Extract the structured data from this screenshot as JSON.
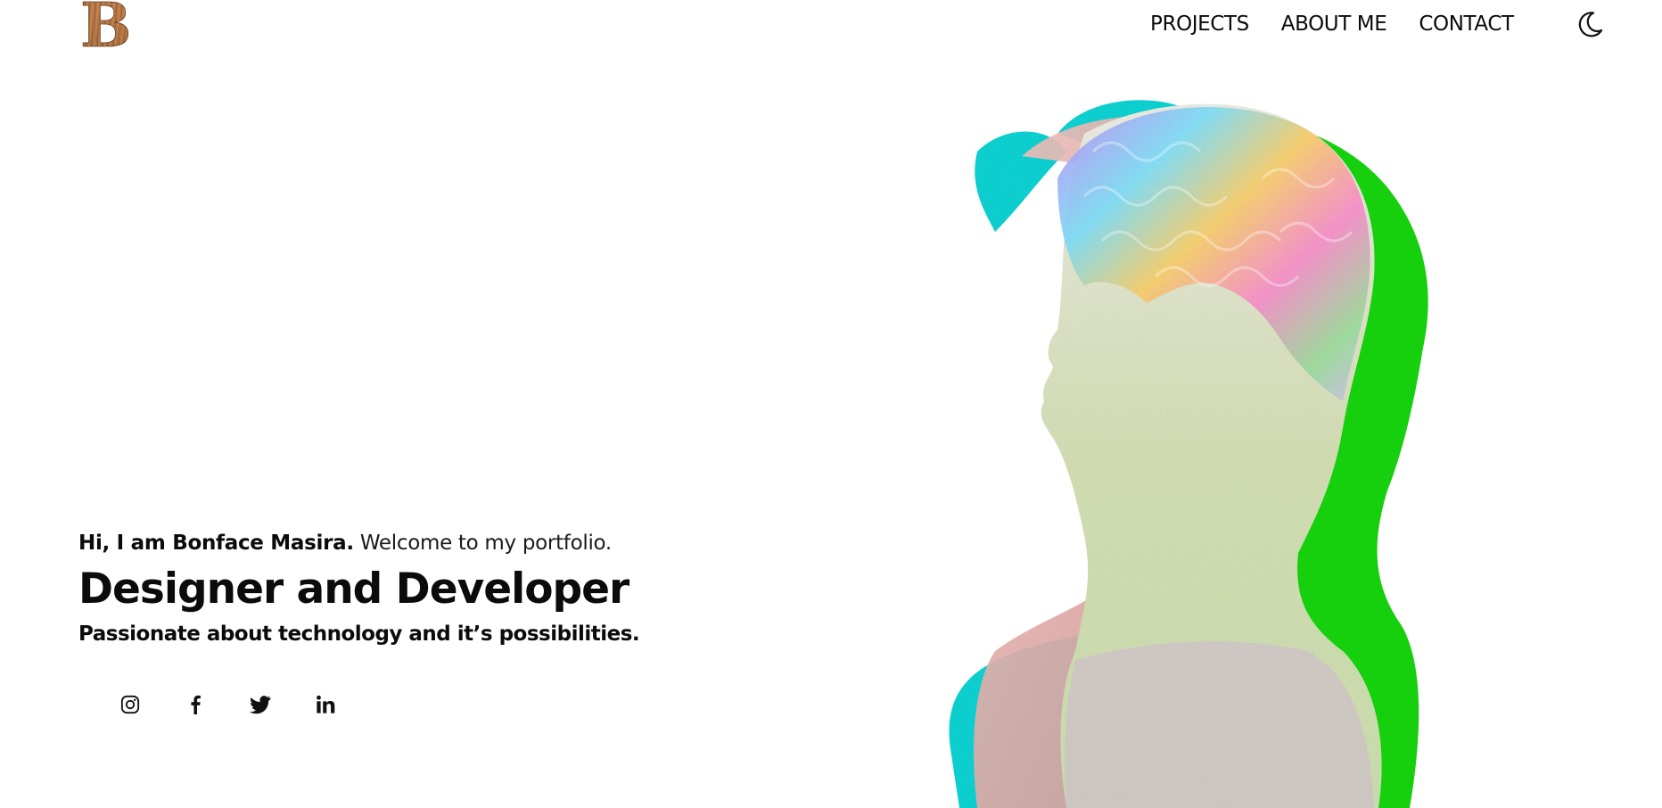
{
  "header": {
    "logo_letter": "B",
    "nav": [
      {
        "label": "PROJECTS"
      },
      {
        "label": "ABOUT ME"
      },
      {
        "label": "CONTACT"
      }
    ],
    "theme_toggle_icon": "moon-icon"
  },
  "hero": {
    "greeting_name": "Hi, I am Bonface Masira.",
    "greeting_welcome": "Welcome to my portfolio.",
    "title": "Designer and Developer",
    "tagline": "Passionate about technology and it’s possibilities."
  },
  "socials": [
    {
      "icon": "instagram-icon"
    },
    {
      "icon": "facebook-icon"
    },
    {
      "icon": "twitter-icon"
    },
    {
      "icon": "linkedin-icon"
    }
  ],
  "artwork": {
    "description_icon": "glitch-bust-image",
    "colors": {
      "cyan": "#12d6d6",
      "green": "#19d812",
      "red_tint": "#e9a3a3",
      "rainbow_a": "#d68cff",
      "rainbow_b": "#ffd36b",
      "rainbow_c": "#7fe3ff"
    }
  },
  "theme": {
    "background": "#ffffff",
    "text": "#0b0b0b",
    "logo_wood_light": "#c98a55",
    "logo_wood_dark": "#7a4b24"
  }
}
